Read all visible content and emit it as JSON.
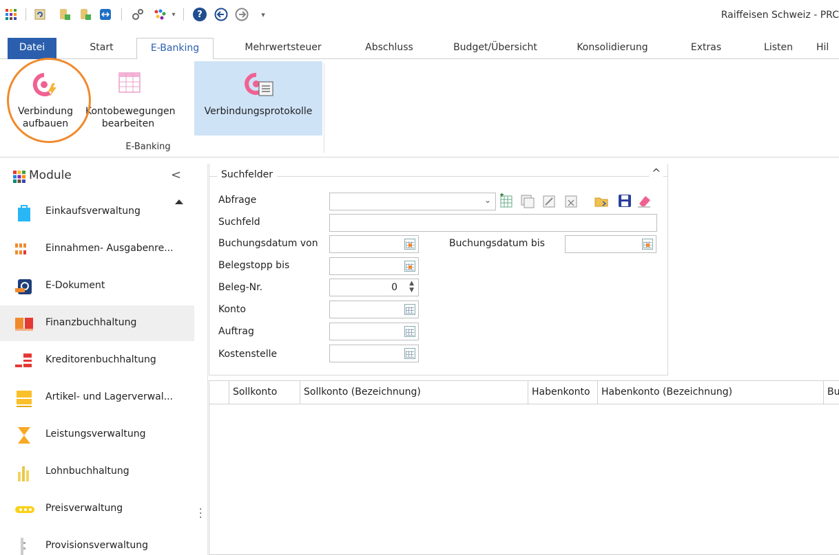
{
  "app": {
    "title": "Raiffeisen Schweiz - PRC"
  },
  "quick_access": {
    "icons": [
      "modules-grid-icon",
      "refresh-icon",
      "database-export-icon",
      "database-import-icon",
      "teamviewer-icon",
      "settings-gears-icon",
      "color-palette-icon",
      "help-icon",
      "back-icon",
      "forward-icon",
      "customize-arrow-icon"
    ]
  },
  "ribbon": {
    "tabs": [
      "Datei",
      "Start",
      "E-Banking",
      "Mehrwertsteuer",
      "Abschluss",
      "Budget/Übersicht",
      "Konsolidierung",
      "Extras",
      "Listen",
      "Hil"
    ],
    "active_tab": "E-Banking",
    "group_label": "E-Banking",
    "buttons": {
      "connect": {
        "line1": "Verbindung",
        "line2": "aufbauen"
      },
      "edit_movements": {
        "line1": "Kontobewegungen",
        "line2": "bearbeiten"
      },
      "protocols": {
        "line1": "Verbindungsprotokolle"
      }
    }
  },
  "sidebar": {
    "title": "Module",
    "collapse": "<",
    "items": [
      {
        "label": "Einkaufsverwaltung",
        "icon": "shopping-bag-icon"
      },
      {
        "label": "Einnahmen- Ausgabenre...",
        "icon": "income-expense-icon"
      },
      {
        "label": "E-Dokument",
        "icon": "e-document-icon"
      },
      {
        "label": "Finanzbuchhaltung",
        "icon": "financial-accounting-icon"
      },
      {
        "label": "Kreditorenbuchhaltung",
        "icon": "creditor-accounting-icon"
      },
      {
        "label": "Artikel- und Lagerverwal...",
        "icon": "warehouse-icon"
      },
      {
        "label": "Leistungsverwaltung",
        "icon": "hourglass-icon"
      },
      {
        "label": "Lohnbuchhaltung",
        "icon": "payroll-icon"
      },
      {
        "label": "Preisverwaltung",
        "icon": "price-tags-icon"
      },
      {
        "label": "Provisionsverwaltung",
        "icon": "commission-icon"
      }
    ],
    "selected": "Finanzbuchhaltung"
  },
  "search": {
    "legend": "Suchfelder",
    "collapse": "^",
    "fields": {
      "abfrage": {
        "label": "Abfrage",
        "value": ""
      },
      "suchfeld": {
        "label": "Suchfeld",
        "value": ""
      },
      "buchungsdatum_von": {
        "label": "Buchungsdatum von",
        "value": ""
      },
      "buchungsdatum_bis": {
        "label": "Buchungsdatum bis",
        "value": ""
      },
      "belegstopp_bis": {
        "label": "Belegstopp bis",
        "value": ""
      },
      "beleg_nr": {
        "label": "Beleg-Nr.",
        "value": "0"
      },
      "konto": {
        "label": "Konto",
        "value": ""
      },
      "auftrag": {
        "label": "Auftrag",
        "value": ""
      },
      "kostenstelle": {
        "label": "Kostenstelle",
        "value": ""
      }
    }
  },
  "grid": {
    "columns": [
      "",
      "Sollkonto",
      "Sollkonto (Bezeichnung)",
      "Habenkonto",
      "Habenkonto (Bezeichnung)",
      "Bu"
    ]
  },
  "colors": {
    "accent": "#2b5fad",
    "highlight_ring": "#f08a2c",
    "selected_ribbon": "#cfe3f7"
  }
}
